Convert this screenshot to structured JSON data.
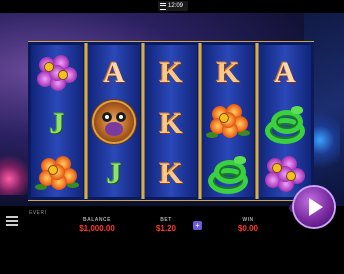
{
  "status_bar": {
    "time": "12:09"
  },
  "brand": {
    "label": "EVERI"
  },
  "reels": [
    [
      "flower-purple",
      "J",
      "flower-orange"
    ],
    [
      "A",
      "owl",
      "J"
    ],
    [
      "K",
      "K",
      "K"
    ],
    [
      "K",
      "flower-orange",
      "snake"
    ],
    [
      "A",
      "snake",
      "flower-purple"
    ]
  ],
  "letters": {
    "A": "A",
    "K": "K",
    "J": "J"
  },
  "hud": {
    "balance_label": "BALANCE",
    "balance_value": "$1,000.00",
    "bet_label": "BET",
    "bet_value": "$1.20",
    "win_label": "WIN",
    "win_value": "$0.00",
    "plus_label": "+"
  },
  "icons": {
    "menu": "hamburger-icon",
    "spin": "play-triangle-icon",
    "bet_increase": "plus-icon"
  },
  "colors": {
    "value_red": "#ff3a2a",
    "spin_purple": "#7a2aa0",
    "reel_blue": "#2a48b8"
  }
}
